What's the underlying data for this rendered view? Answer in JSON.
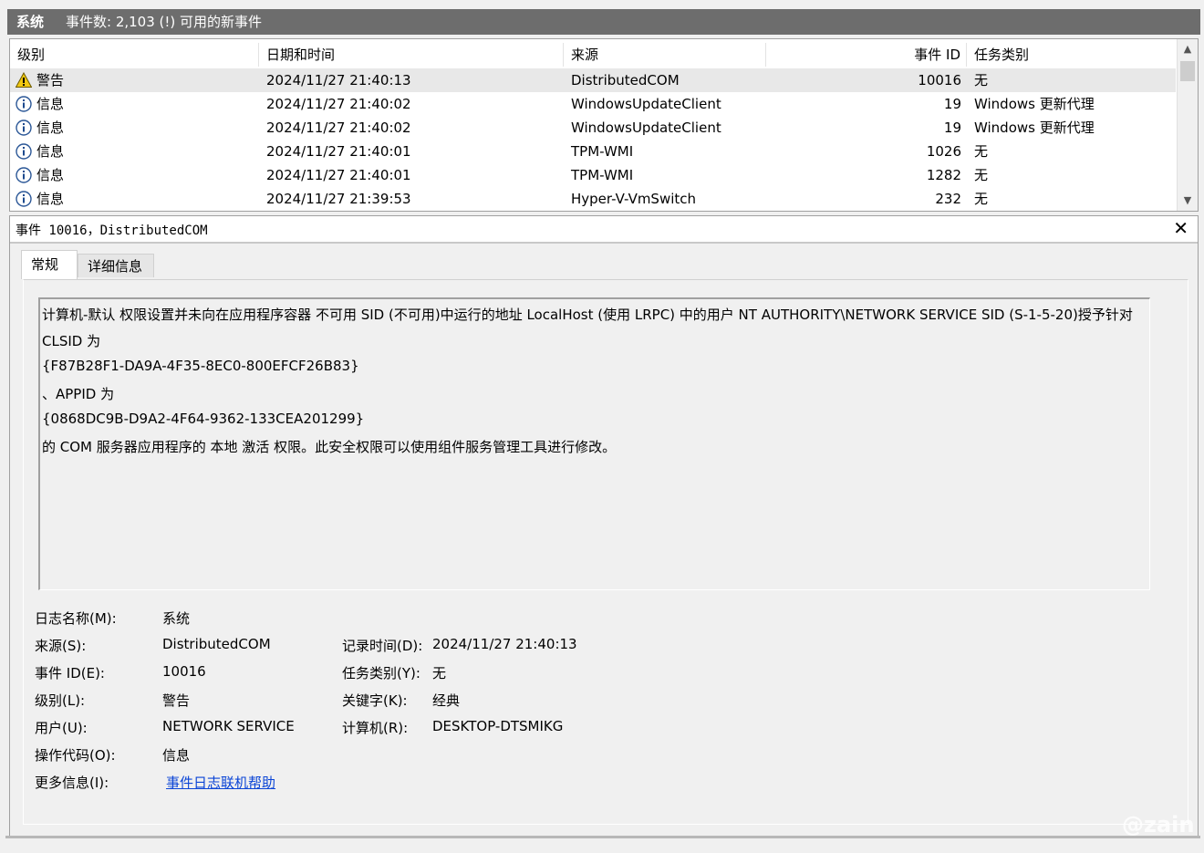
{
  "titlebar": {
    "name": "系统",
    "count": "事件数: 2,103 (!) 可用的新事件"
  },
  "columns": {
    "level": "级别",
    "datetime": "日期和时间",
    "source": "来源",
    "event_id": "事件 ID",
    "task": "任务类别"
  },
  "events": [
    {
      "icon": "warning-icon",
      "level": "警告",
      "datetime": "2024/11/27 21:40:13",
      "source": "DistributedCOM",
      "event_id": "10016",
      "task": "无"
    },
    {
      "icon": "info-icon",
      "level": "信息",
      "datetime": "2024/11/27 21:40:02",
      "source": "WindowsUpdateClient",
      "event_id": "19",
      "task": "Windows 更新代理"
    },
    {
      "icon": "info-icon",
      "level": "信息",
      "datetime": "2024/11/27 21:40:02",
      "source": "WindowsUpdateClient",
      "event_id": "19",
      "task": "Windows 更新代理"
    },
    {
      "icon": "info-icon",
      "level": "信息",
      "datetime": "2024/11/27 21:40:01",
      "source": "TPM-WMI",
      "event_id": "1026",
      "task": "无"
    },
    {
      "icon": "info-icon",
      "level": "信息",
      "datetime": "2024/11/27 21:40:01",
      "source": "TPM-WMI",
      "event_id": "1282",
      "task": "无"
    },
    {
      "icon": "info-icon",
      "level": "信息",
      "datetime": "2024/11/27 21:39:53",
      "source": "Hyper-V-VmSwitch",
      "event_id": "232",
      "task": "无"
    }
  ],
  "detail": {
    "title": "事件 10016，DistributedCOM",
    "close": "✕",
    "tabs": {
      "general": "常规",
      "details": "详细信息"
    },
    "message": [
      "计算机-默认 权限设置并未向在应用程序容器 不可用 SID (不可用)中运行的地址 LocalHost (使用 LRPC) 中的用户 NT AUTHORITY\\NETWORK SERVICE SID (S-1-5-20)授予针对",
      "CLSID 为",
      "{F87B28F1-DA9A-4F35-8EC0-800EFCF26B83}",
      "、APPID 为",
      "{0868DC9B-D9A2-4F64-9362-133CEA201299}",
      " 的 COM 服务器应用程序的 本地 激活 权限。此安全权限可以使用组件服务管理工具进行修改。"
    ],
    "props": {
      "log_name_label": "日志名称(M):",
      "log_name": "系统",
      "source_label": "来源(S):",
      "source": "DistributedCOM",
      "logged_label": "记录时间(D):",
      "logged": "2024/11/27 21:40:13",
      "event_id_label": "事件 ID(E):",
      "event_id": "10016",
      "task_label": "任务类别(Y):",
      "task": "无",
      "level_label": "级别(L):",
      "level": "警告",
      "keywords_label": "关键字(K):",
      "keywords": "经典",
      "user_label": "用户(U):",
      "user": "NETWORK SERVICE",
      "computer_label": "计算机(R):",
      "computer": "DESKTOP-DTSMIKG",
      "opcode_label": "操作代码(O):",
      "opcode": "信息",
      "more_info_label": "更多信息(I):",
      "more_info_link": "事件日志联机帮助"
    }
  },
  "scroll": {
    "up": "▲",
    "down": "▼"
  },
  "watermark": "@zain"
}
